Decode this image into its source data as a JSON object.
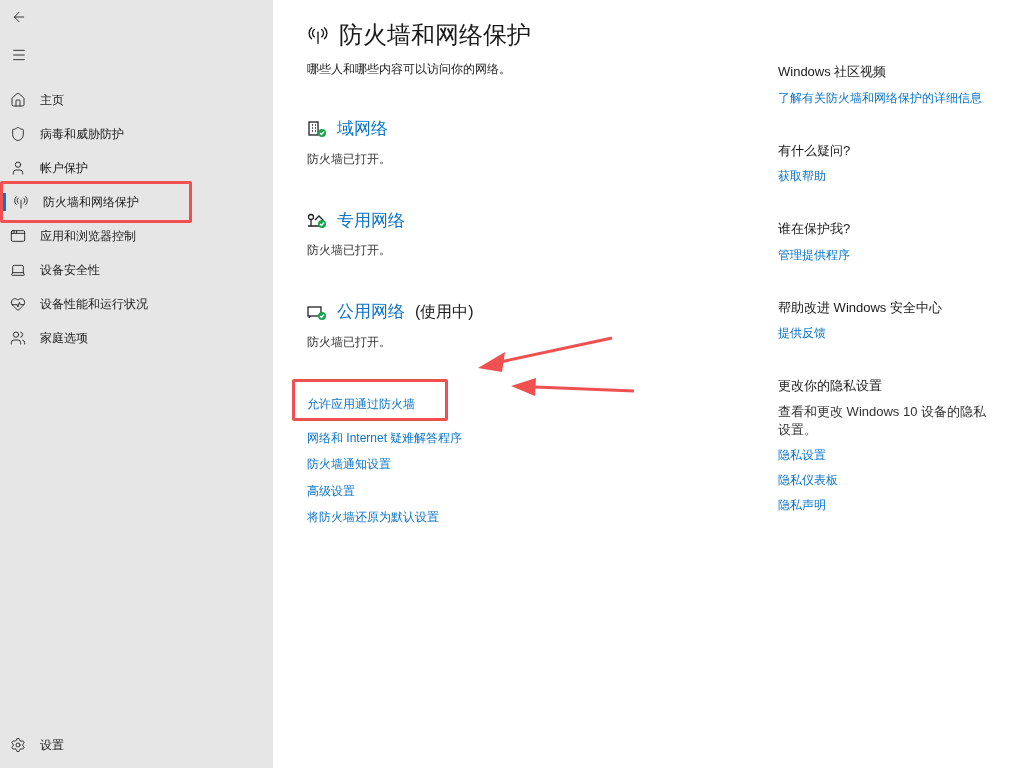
{
  "sidebar": {
    "items": [
      {
        "label": "主页",
        "kind": "home",
        "selected": false,
        "highlighted": false
      },
      {
        "label": "病毒和威胁防护",
        "kind": "shield",
        "selected": false,
        "highlighted": false
      },
      {
        "label": "帐户保护",
        "kind": "user",
        "selected": false,
        "highlighted": false
      },
      {
        "label": "防火墙和网络保护",
        "kind": "antenna",
        "selected": true,
        "highlighted": true
      },
      {
        "label": "应用和浏览器控制",
        "kind": "window",
        "selected": false,
        "highlighted": false
      },
      {
        "label": "设备安全性",
        "kind": "laptop",
        "selected": false,
        "highlighted": false
      },
      {
        "label": "设备性能和运行状况",
        "kind": "heart",
        "selected": false,
        "highlighted": false
      },
      {
        "label": "家庭选项",
        "kind": "family",
        "selected": false,
        "highlighted": false
      }
    ],
    "settings": "设置"
  },
  "page": {
    "title": "防火墙和网络保护",
    "subtitle": "哪些人和哪些内容可以访问你的网络。",
    "networks": [
      {
        "kind": "domain",
        "name": "域网络",
        "status": "防火墙已打开。"
      },
      {
        "kind": "private",
        "name": "专用网络",
        "status": "防火墙已打开。"
      },
      {
        "kind": "public",
        "name": "公用网络",
        "in_use": "(使用中)",
        "status": "防火墙已打开。"
      }
    ],
    "links": [
      {
        "label": "允许应用通过防火墙",
        "highlighted": true
      },
      {
        "label": "网络和 Internet 疑难解答程序",
        "highlighted": false
      },
      {
        "label": "防火墙通知设置",
        "highlighted": false
      },
      {
        "label": "高级设置",
        "highlighted": false
      },
      {
        "label": "将防火墙还原为默认设置",
        "highlighted": false
      }
    ]
  },
  "aside": [
    {
      "heading": "Windows 社区视频",
      "links": [
        "了解有关防火墙和网络保护的详细信息"
      ]
    },
    {
      "heading": "有什么疑问?",
      "links": [
        "获取帮助"
      ]
    },
    {
      "heading": "谁在保护我?",
      "links": [
        "管理提供程序"
      ]
    },
    {
      "heading": "帮助改进 Windows 安全中心",
      "links": [
        "提供反馈"
      ]
    },
    {
      "heading": "更改你的隐私设置",
      "text": "查看和更改 Windows 10 设备的隐私设置。",
      "links": [
        "隐私设置",
        "隐私仪表板",
        "隐私声明"
      ]
    }
  ]
}
